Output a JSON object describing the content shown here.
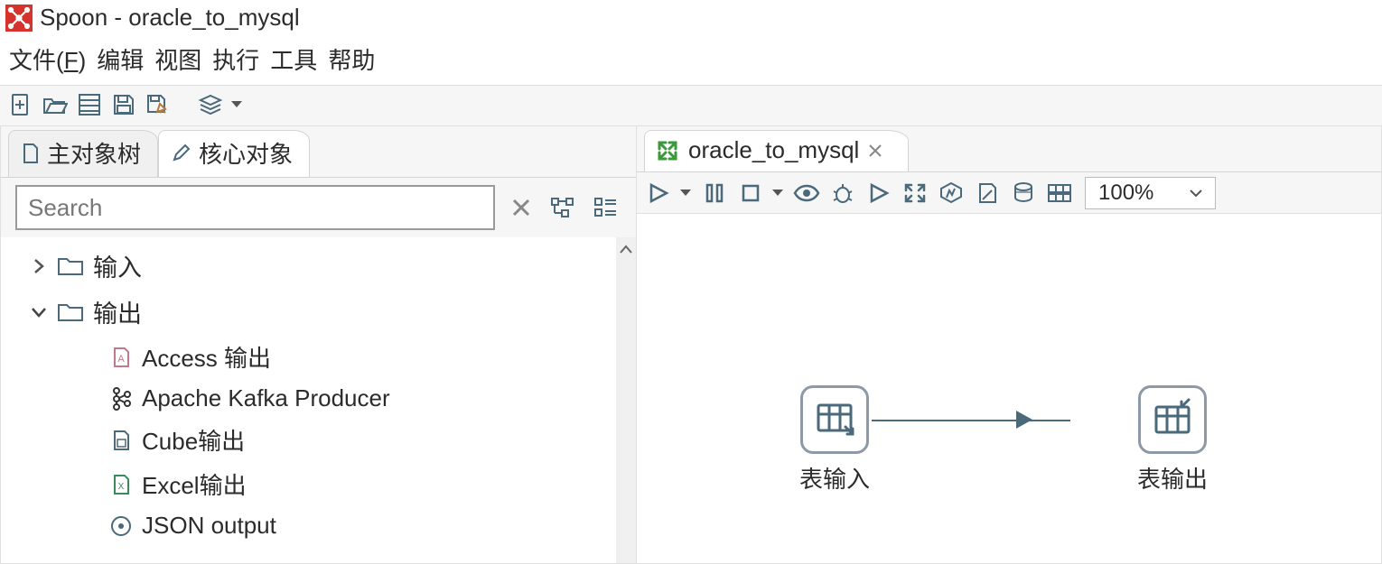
{
  "window": {
    "title": "Spoon - oracle_to_mysql"
  },
  "menu": {
    "file": {
      "label": "文件",
      "hotkey": "F"
    },
    "edit": "编辑",
    "view": "视图",
    "run": "执行",
    "tools": "工具",
    "help": "帮助"
  },
  "left_tabs": {
    "main_tree": "主对象树",
    "core": "核心对象"
  },
  "search": {
    "placeholder": "Search"
  },
  "tree": {
    "input": "输入",
    "output": "输出",
    "output_children": [
      "Access 输出",
      "Apache Kafka Producer",
      "Cube输出",
      "Excel输出",
      "JSON output"
    ]
  },
  "right_tab": {
    "name": "oracle_to_mysql"
  },
  "zoom": "100%",
  "steps": {
    "table_input": "表输入",
    "table_output": "表输出"
  }
}
